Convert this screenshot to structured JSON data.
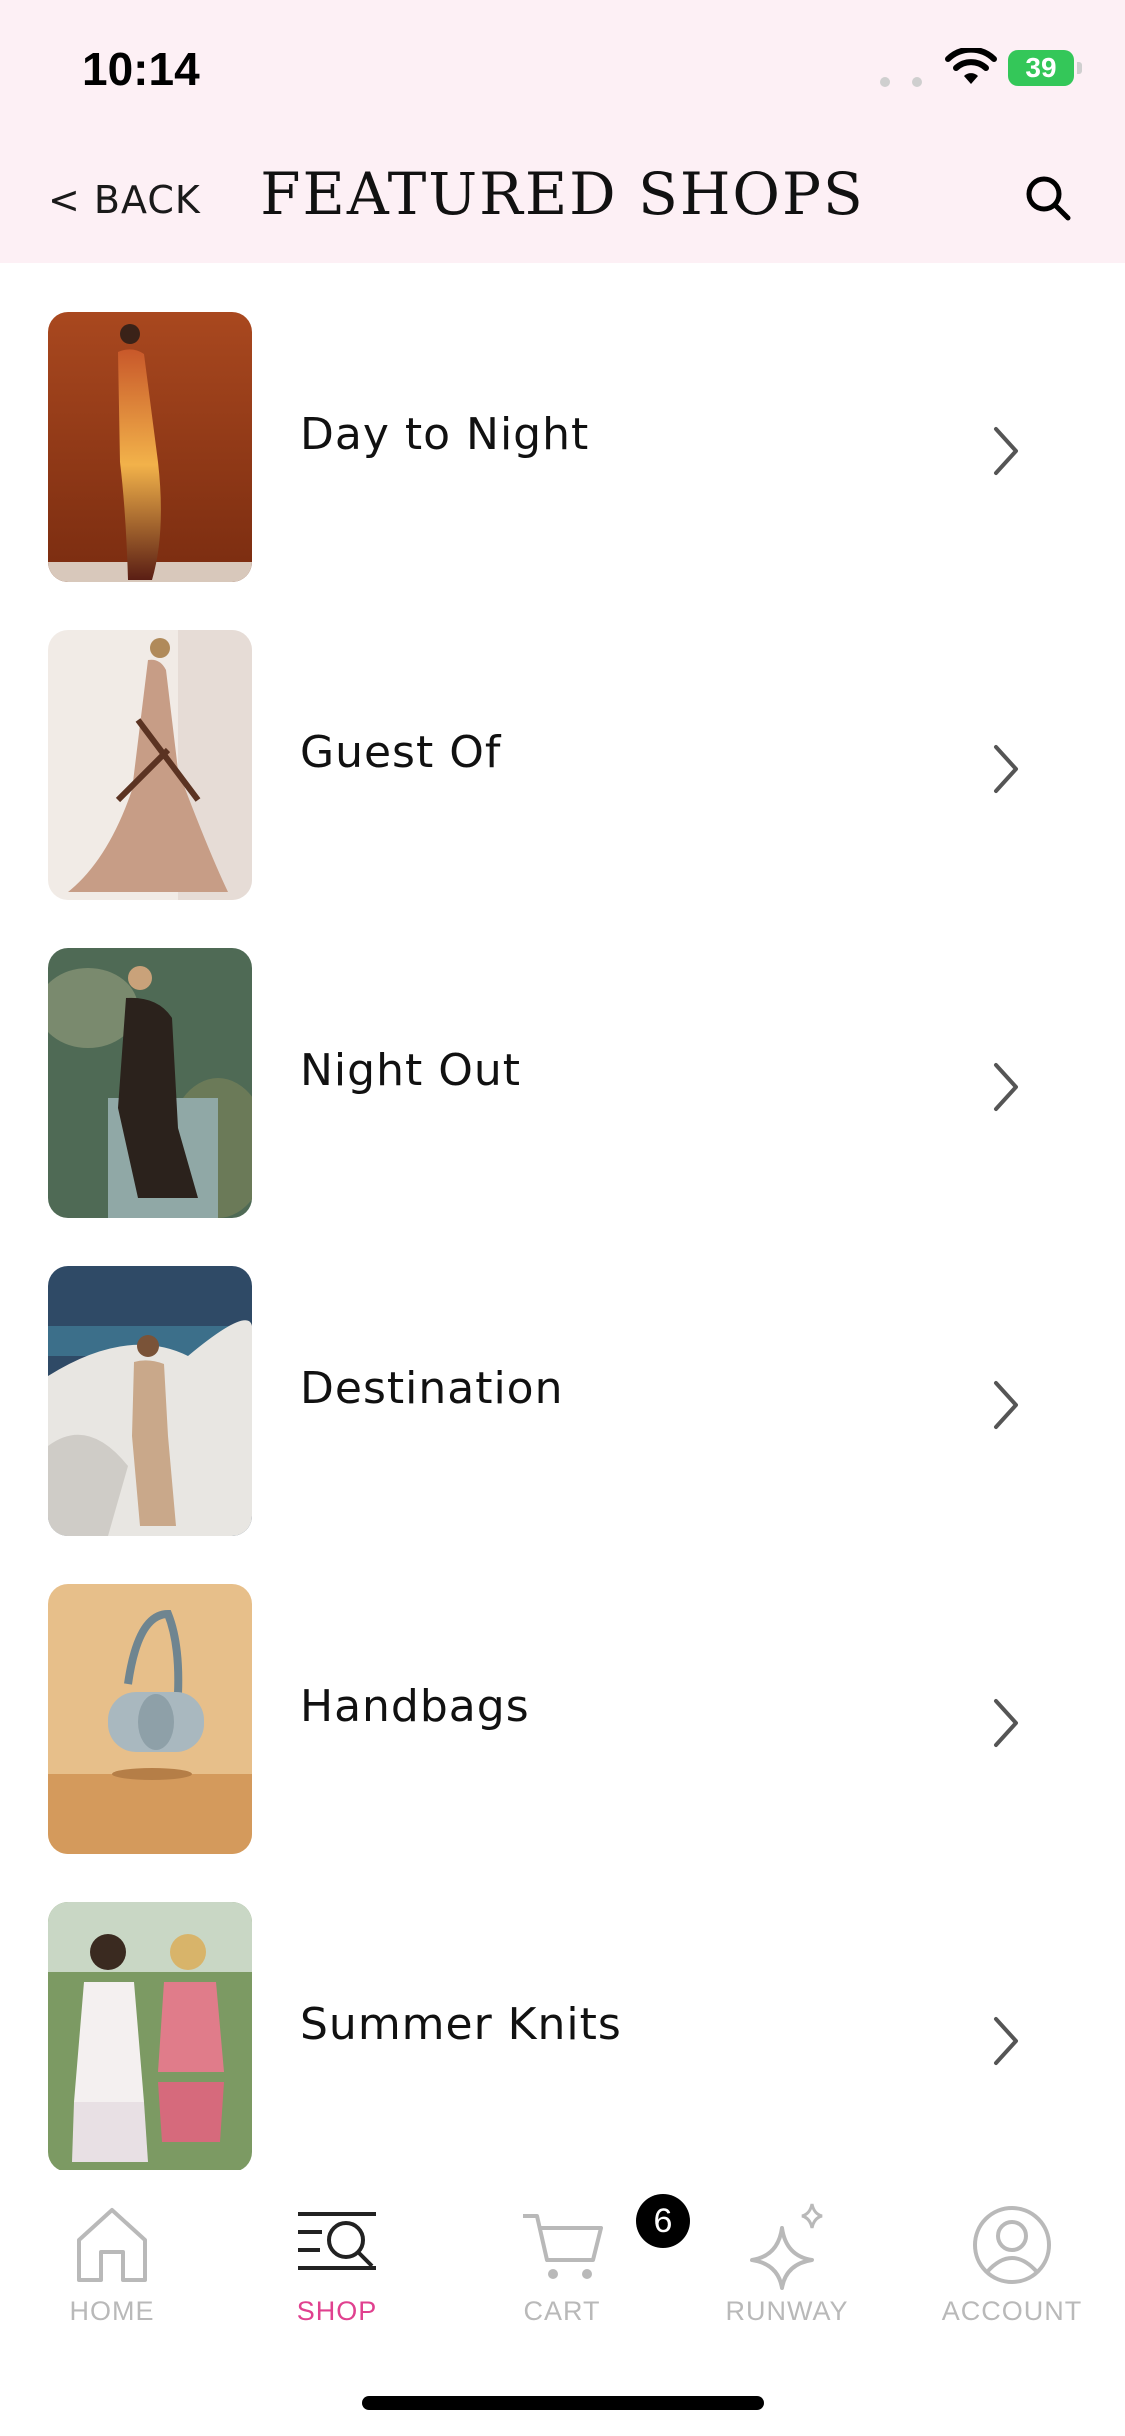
{
  "status_bar": {
    "time": "10:14",
    "battery": "39"
  },
  "nav": {
    "back_label": "< BACK",
    "title": "FEATURED SHOPS"
  },
  "shops": [
    {
      "label": "Day to Night"
    },
    {
      "label": "Guest Of"
    },
    {
      "label": "Night Out"
    },
    {
      "label": "Destination"
    },
    {
      "label": "Handbags"
    },
    {
      "label": "Summer Knits"
    }
  ],
  "tabs": [
    {
      "label": "HOME",
      "icon": "home-icon",
      "active": false
    },
    {
      "label": "SHOP",
      "icon": "shop-search-icon",
      "active": true
    },
    {
      "label": "CART",
      "icon": "cart-icon",
      "active": false
    },
    {
      "label": "RUNWAY",
      "icon": "sparkle-icon",
      "active": false
    },
    {
      "label": "ACCOUNT",
      "icon": "account-icon",
      "active": false
    }
  ],
  "cart_badge": "6",
  "colors": {
    "header_bg": "#fdf0f5",
    "accent": "#e0418f",
    "battery": "#34c759"
  }
}
